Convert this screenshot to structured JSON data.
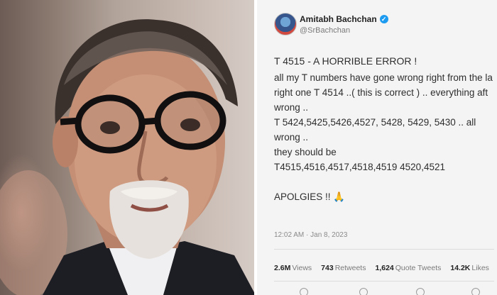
{
  "tweet": {
    "author_name": "Amitabh Bachchan",
    "handle": "@SrBachchan",
    "lines": [
      "T 4515 - A HORRIBLE ERROR !",
      "all my T numbers have gone wrong right from the la",
      "right one T 4514 ..( this is correct ) .. everything aft",
      "wrong ..",
      "T 5424,5425,5426,4527, 5428, 5429, 5430 .. all",
      "wrong ..",
      "they should be",
      "T4515,4516,4517,4518,4519 4520,4521",
      "APOLGIES !! 🙏"
    ],
    "timestamp": "12:02 AM · Jan 8, 2023",
    "stats": {
      "views_count": "2.6M",
      "views_label": "Views",
      "retweets_count": "743",
      "retweets_label": "Retweets",
      "quotes_count": "1,624",
      "quotes_label": "Quote Tweets",
      "likes_count": "14.2K",
      "likes_label": "Likes"
    },
    "colors": {
      "verified": "#1d9bf0",
      "panel_bg": "#f4f4f4"
    }
  }
}
